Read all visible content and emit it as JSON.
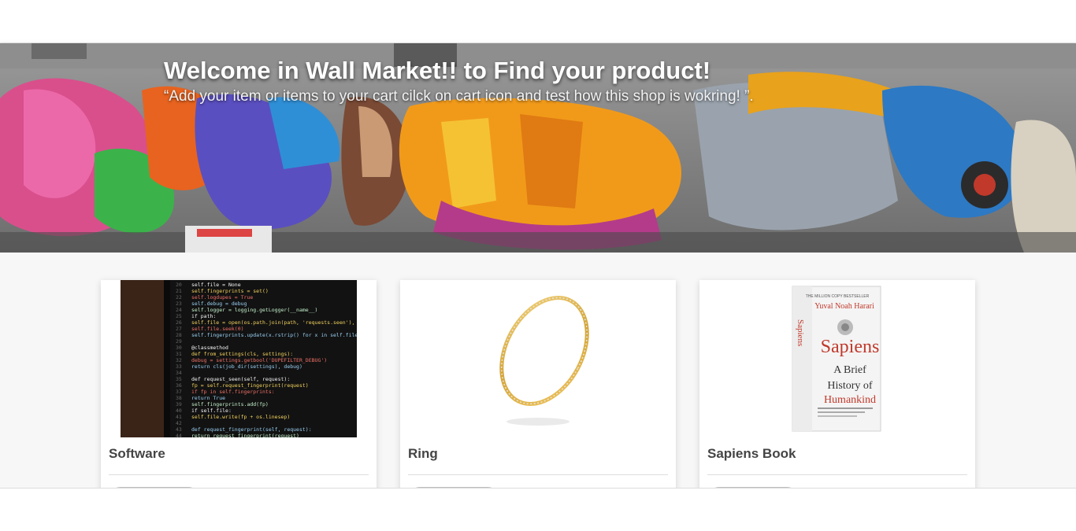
{
  "hero": {
    "title": "Welcome in Wall Market!! to Find your product!",
    "subtitle": "“Add your item or items to your cart cilck on cart icon and test how this shop is wokring! ”."
  },
  "products": [
    {
      "name": "Software",
      "image": "code-screen-photo"
    },
    {
      "name": "Ring",
      "image": "gold-ring-photo"
    },
    {
      "name": "Sapiens Book",
      "image": "sapiens-book-cover"
    }
  ],
  "book_cover": {
    "top_line": "THE MILLION COPY BESTSELLER",
    "author": "Yuval Noah Harari",
    "title": "Sapiens",
    "subtitle_1": "A Brief",
    "subtitle_2": "History of",
    "subtitle_3": "Humankind",
    "spine_title": "Sapiens"
  },
  "code_lines": [
    "self.file = None",
    "self.fingerprints = set()",
    "self.logdupes = True",
    "self.debug = debug",
    "self.logger = logging.getLogger(__name__)",
    "if path:",
    "    self.file = open(os.path.join(path, 'requests.seen'), 'a+')",
    "    self.file.seek(0)",
    "    self.fingerprints.update(x.rstrip() for x in self.file)",
    "",
    "@classmethod",
    "def from_settings(cls, settings):",
    "    debug = settings.getbool('DUPEFILTER_DEBUG')",
    "    return cls(job_dir(settings), debug)",
    "",
    "def request_seen(self, request):",
    "    fp = self.request_fingerprint(request)",
    "    if fp in self.fingerprints:",
    "        return True",
    "    self.fingerprints.add(fp)",
    "    if self.file:",
    "        self.file.write(fp + os.linesep)",
    "",
    "def request_fingerprint(self, request):",
    "    return request_fingerprint(request)"
  ],
  "colors": {
    "hero_text": "#ffffff",
    "card_title": "#444444",
    "page_bg": "#f7f7f7",
    "book_red": "#c0392b"
  }
}
